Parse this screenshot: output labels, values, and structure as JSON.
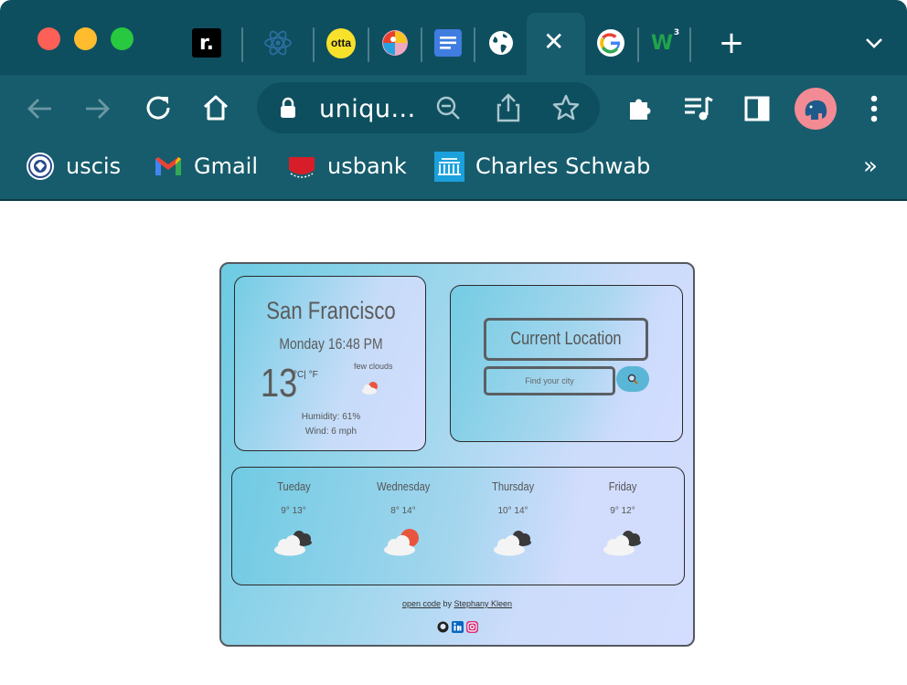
{
  "browser": {
    "tabs": [
      {
        "name": "r-tab",
        "glyph": "r."
      },
      {
        "name": "react-tab",
        "glyph": ""
      },
      {
        "name": "otta-tab",
        "glyph": "otta"
      },
      {
        "name": "colorful-tab",
        "glyph": ""
      },
      {
        "name": "docs-tab",
        "glyph": ""
      },
      {
        "name": "globe-tab",
        "glyph": ""
      },
      {
        "name": "google-tab",
        "glyph": "G"
      },
      {
        "name": "w3-tab",
        "glyph": "W"
      }
    ],
    "active_tab_close": "✕",
    "new_tab": "+",
    "url": "uniqu...",
    "bookmarks": [
      {
        "label": "uscis"
      },
      {
        "label": "Gmail"
      },
      {
        "label": "usbank"
      },
      {
        "label": "Charles Schwab"
      }
    ],
    "bookmarks_more": "»"
  },
  "weather": {
    "current": {
      "city": "San Francisco",
      "datetime": "Monday 16:48 PM",
      "temperature": "13",
      "units": "°C| °F",
      "description": "few clouds",
      "humidity": "Humidity: 61%",
      "wind": "Wind: 6 mph"
    },
    "search": {
      "current_location_label": "Current Location",
      "placeholder": "Find your city"
    },
    "forecast": [
      {
        "day": "Tueday",
        "range": "9° 13°",
        "icon": "cloudy-icon"
      },
      {
        "day": "Wednesday",
        "range": "8° 14°",
        "icon": "partly-sunny-icon"
      },
      {
        "day": "Thursday",
        "range": "10° 14°",
        "icon": "cloudy-icon"
      },
      {
        "day": "Friday",
        "range": "9° 12°",
        "icon": "cloudy-icon"
      }
    ],
    "footer": {
      "open_code": "open code",
      "by": " by ",
      "author": "Stephany Kleen"
    }
  },
  "colors": {
    "chrome_dark": "#0e4f5f",
    "chrome": "#175c6c",
    "search_button": "#5ab6d6"
  }
}
